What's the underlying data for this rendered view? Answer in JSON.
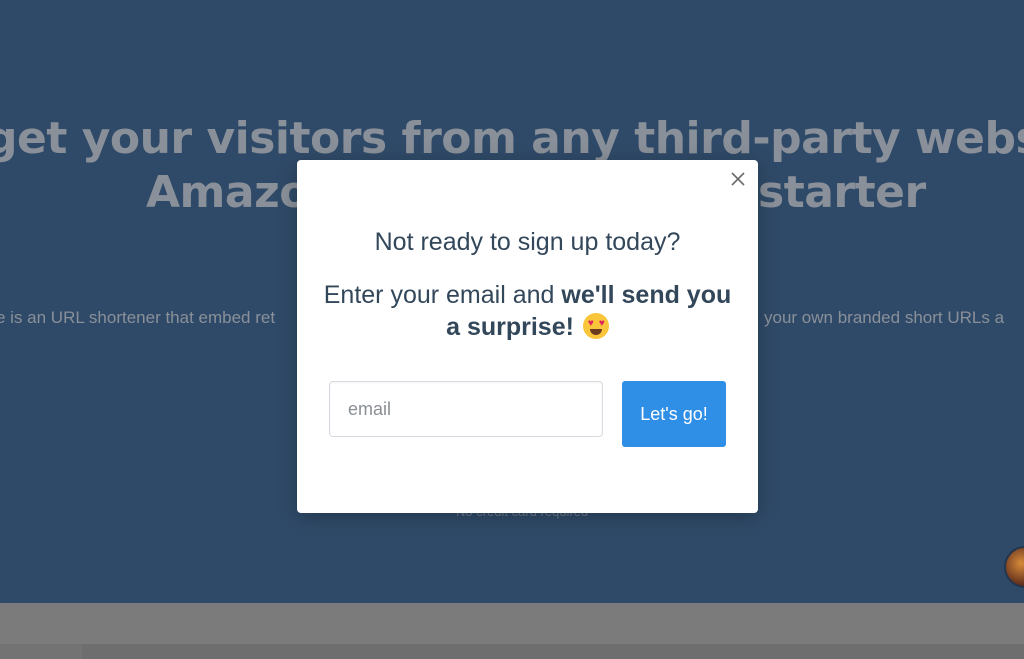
{
  "background": {
    "headline_line1": "get your visitors from any third-party websi",
    "headline_line2_left": "Amazo",
    "headline_line2_right": "starter",
    "subtitle_left": "e is an URL shortener that embed ret",
    "subtitle_right": "your own branded short URLs a",
    "no_card_note": "No credit card required"
  },
  "modal": {
    "title": "Not ready to sign up today?",
    "message_normal": "Enter your email and ",
    "message_bold": "we'll send you a surprise!",
    "emoji_icon": "heart-eyes-emoji-icon",
    "email_placeholder": "email",
    "submit_label": "Let's go!",
    "close_icon": "close-icon"
  },
  "colors": {
    "overlay_bg": "#2f4a68",
    "accent_button": "#2f8ee6",
    "text": "#33475b"
  }
}
